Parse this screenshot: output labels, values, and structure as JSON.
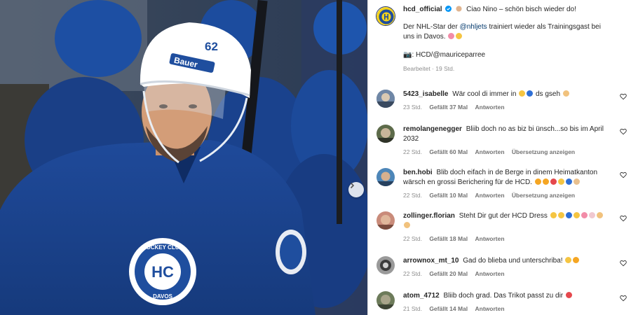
{
  "post": {
    "account": "hcd_official",
    "caption_line1": "Ciao Nino – schön bisch wieder do!",
    "caption_line2_a": "Der NHL-Star der",
    "caption_mention": "@nhljets",
    "caption_line2_b": "trainiert wieder als Trainingsgast bei uns in Davos.",
    "caption_credit": "📷: HCD/@mauriceparree",
    "caption_meta": "Bearbeitet · 19 Std.",
    "jersey_number": "62",
    "helmet_brand": "Bauer",
    "crest_text_top": "HOCKEY CLUB",
    "crest_text_bottom": "DAVOS",
    "crest_monogram": "HC"
  },
  "comments": [
    {
      "user": "5423_isabelle",
      "text": "Wär cool di immer in",
      "text_after": "ds gseh",
      "time": "23 Std.",
      "likes": "Gefällt 37 Mal",
      "reply": "Antworten",
      "translate": ""
    },
    {
      "user": "remolangenegger",
      "text": "Bliib doch no as biz bi ünsch...so bis im April 2032",
      "text_after": "",
      "time": "22 Std.",
      "likes": "Gefällt 60 Mal",
      "reply": "Antworten",
      "translate": "Übersetzung anzeigen"
    },
    {
      "user": "ben.hobi",
      "text": "Blib doch eifach in de Berge in dinem Heimatkanton wärsch en grossi Berichering für de HCD.",
      "text_after": "",
      "time": "22 Std.",
      "likes": "Gefällt 10 Mal",
      "reply": "Antworten",
      "translate": "Übersetzung anzeigen"
    },
    {
      "user": "zollinger.florian",
      "text": "Steht Dir gut der HCD Dress",
      "text_after": "",
      "time": "22 Std.",
      "likes": "Gefällt 18 Mal",
      "reply": "Antworten",
      "translate": ""
    },
    {
      "user": "arrownox_mt_10",
      "text": "Gad do blieba und unterschriba!",
      "text_after": "",
      "time": "22 Std.",
      "likes": "Gefällt 20 Mal",
      "reply": "Antworten",
      "translate": ""
    },
    {
      "user": "atom_4712",
      "text": "Bliib doch grad. Das Trikot passt zu dir",
      "text_after": "",
      "time": "21 Std.",
      "likes": "Gefällt 14 Mal",
      "reply": "Antworten",
      "translate": ""
    }
  ],
  "colors": {
    "hcd_blue": "#1f4e9e",
    "hcd_yellow": "#f3d21b",
    "link": "#00376b",
    "muted": "#8e8e8e",
    "verified": "#0095f6"
  },
  "icons": {
    "like": "heart-outline-icon",
    "verified": "verified-badge-icon",
    "carousel_next": "chevron-right-icon"
  }
}
